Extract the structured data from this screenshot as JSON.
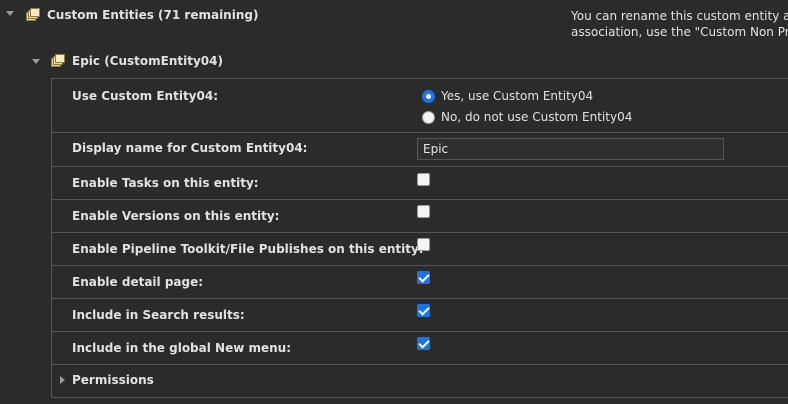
{
  "section": {
    "title": "Custom Entities (71 remaining)",
    "help_line1": "You can rename this custom entity and",
    "help_line2": "association, use the \"Custom Non Project"
  },
  "entity": {
    "title": "Epic (CustomEntity04)"
  },
  "form": {
    "use_label": "Use Custom Entity04:",
    "use_yes": "Yes, use Custom Entity04",
    "use_no": "No, do not use Custom Entity04",
    "use_selected": "yes",
    "display_name_label": "Display name for Custom Entity04:",
    "display_name_value": "Epic",
    "rows": [
      {
        "label": "Enable Tasks on this entity:",
        "checked": false
      },
      {
        "label": "Enable Versions on this entity:",
        "checked": false
      },
      {
        "label": "Enable Pipeline Toolkit/File Publishes on this entity:",
        "checked": false
      },
      {
        "label": "Enable detail page:",
        "checked": true
      },
      {
        "label": "Include in Search results:",
        "checked": true
      },
      {
        "label": "Include in the global New menu:",
        "checked": true
      }
    ],
    "permissions_label": "Permissions"
  },
  "colors": {
    "accent": "#1a73e8",
    "background": "#2b2b2b",
    "border": "#555555"
  }
}
